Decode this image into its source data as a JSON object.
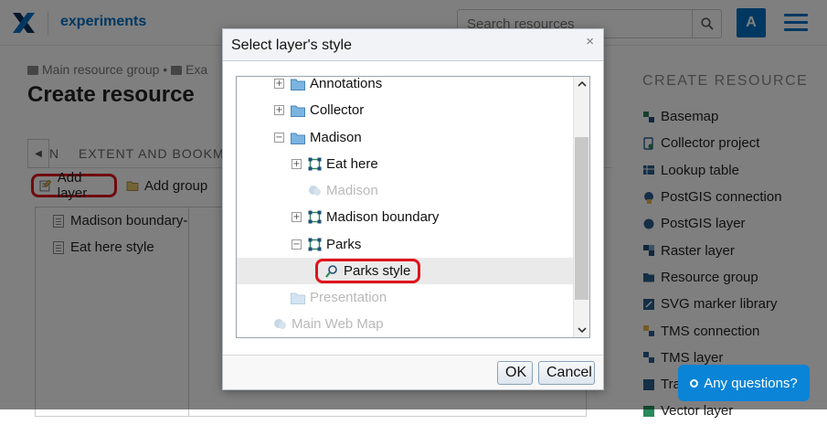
{
  "header": {
    "app_title": "experiments",
    "search_placeholder": "Search resources",
    "avatar_letter": "A"
  },
  "breadcrumb": [
    "Main resource group",
    "•",
    "Exa"
  ],
  "page_title": "Create resource",
  "tabs": {
    "prev_tab_letter": "N",
    "extent_label": "EXTENT AND BOOKM"
  },
  "toolbar": {
    "add_layer": "Add layer",
    "add_group": "Add group"
  },
  "layers": [
    "Madison boundary-",
    "Eat here style"
  ],
  "create_resource": {
    "heading": "CREATE RESOURCE",
    "items": [
      {
        "label": "Basemap",
        "icon": "basemap-icon"
      },
      {
        "label": "Collector project",
        "icon": "collector-icon"
      },
      {
        "label": "Lookup table",
        "icon": "table-icon"
      },
      {
        "label": "PostGIS connection",
        "icon": "postgis-connection-icon"
      },
      {
        "label": "PostGIS layer",
        "icon": "postgis-layer-icon"
      },
      {
        "label": "Raster layer",
        "icon": "raster-icon"
      },
      {
        "label": "Resource group",
        "icon": "folder-icon"
      },
      {
        "label": "SVG marker library",
        "icon": "svg-library-icon"
      },
      {
        "label": "TMS connection",
        "icon": "tms-connection-icon"
      },
      {
        "label": "TMS layer",
        "icon": "tms-layer-icon"
      },
      {
        "label": "Tra",
        "icon": "trackers-icon"
      },
      {
        "label": "Vector layer",
        "icon": "vector-layer-icon"
      }
    ]
  },
  "dialog": {
    "title": "Select layer's style",
    "close_glyph": "×",
    "tree": [
      {
        "label": "Annotations",
        "expander": "+",
        "type": "folder"
      },
      {
        "label": "Collector",
        "expander": "+",
        "type": "folder"
      },
      {
        "label": "Madison",
        "expander": "−",
        "type": "folder"
      },
      {
        "label": "Eat here",
        "expander": "+",
        "type": "vector"
      },
      {
        "label": "Madison",
        "expander": "",
        "type": "webmap-disabled"
      },
      {
        "label": "Madison boundary",
        "expander": "+",
        "type": "vector"
      },
      {
        "label": "Parks",
        "expander": "−",
        "type": "vector"
      },
      {
        "label": "Parks style",
        "expander": "",
        "type": "style",
        "selected": true
      },
      {
        "label": "Presentation",
        "expander": "",
        "type": "folder-disabled"
      },
      {
        "label": "Main Web Map",
        "expander": "",
        "type": "webmap-disabled"
      }
    ],
    "ok_label": "OK",
    "cancel_label": "Cancel"
  },
  "help": {
    "label": "Any questions?"
  },
  "colors": {
    "brand": "#0070c5",
    "highlight": "#e0141c",
    "help": "#0a84d6"
  }
}
